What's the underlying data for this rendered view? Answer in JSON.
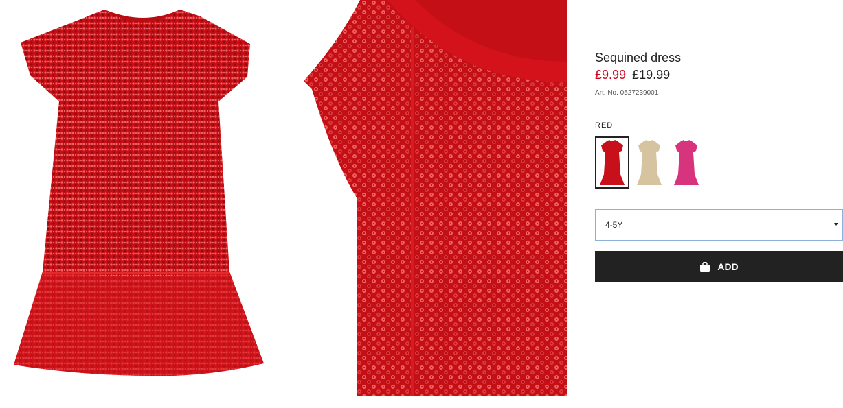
{
  "product": {
    "title": "Sequined dress",
    "price_current": "£9.99",
    "price_old": "£19.99",
    "article_number": "Art. No. 0527239001"
  },
  "color": {
    "selected_label": "RED",
    "swatches": [
      {
        "name": "red",
        "hex": "#c8101a",
        "selected": true
      },
      {
        "name": "gold",
        "hex": "#d6c3a0",
        "selected": false
      },
      {
        "name": "pink",
        "hex": "#d8347e",
        "selected": false
      }
    ]
  },
  "size_select": {
    "value": "4-5Y"
  },
  "add_button": {
    "label": "ADD",
    "icon": "shopping-bag-icon"
  },
  "colors": {
    "sale_red": "#d0021b",
    "button_bg": "#222222",
    "select_border": "#8eb1db"
  }
}
